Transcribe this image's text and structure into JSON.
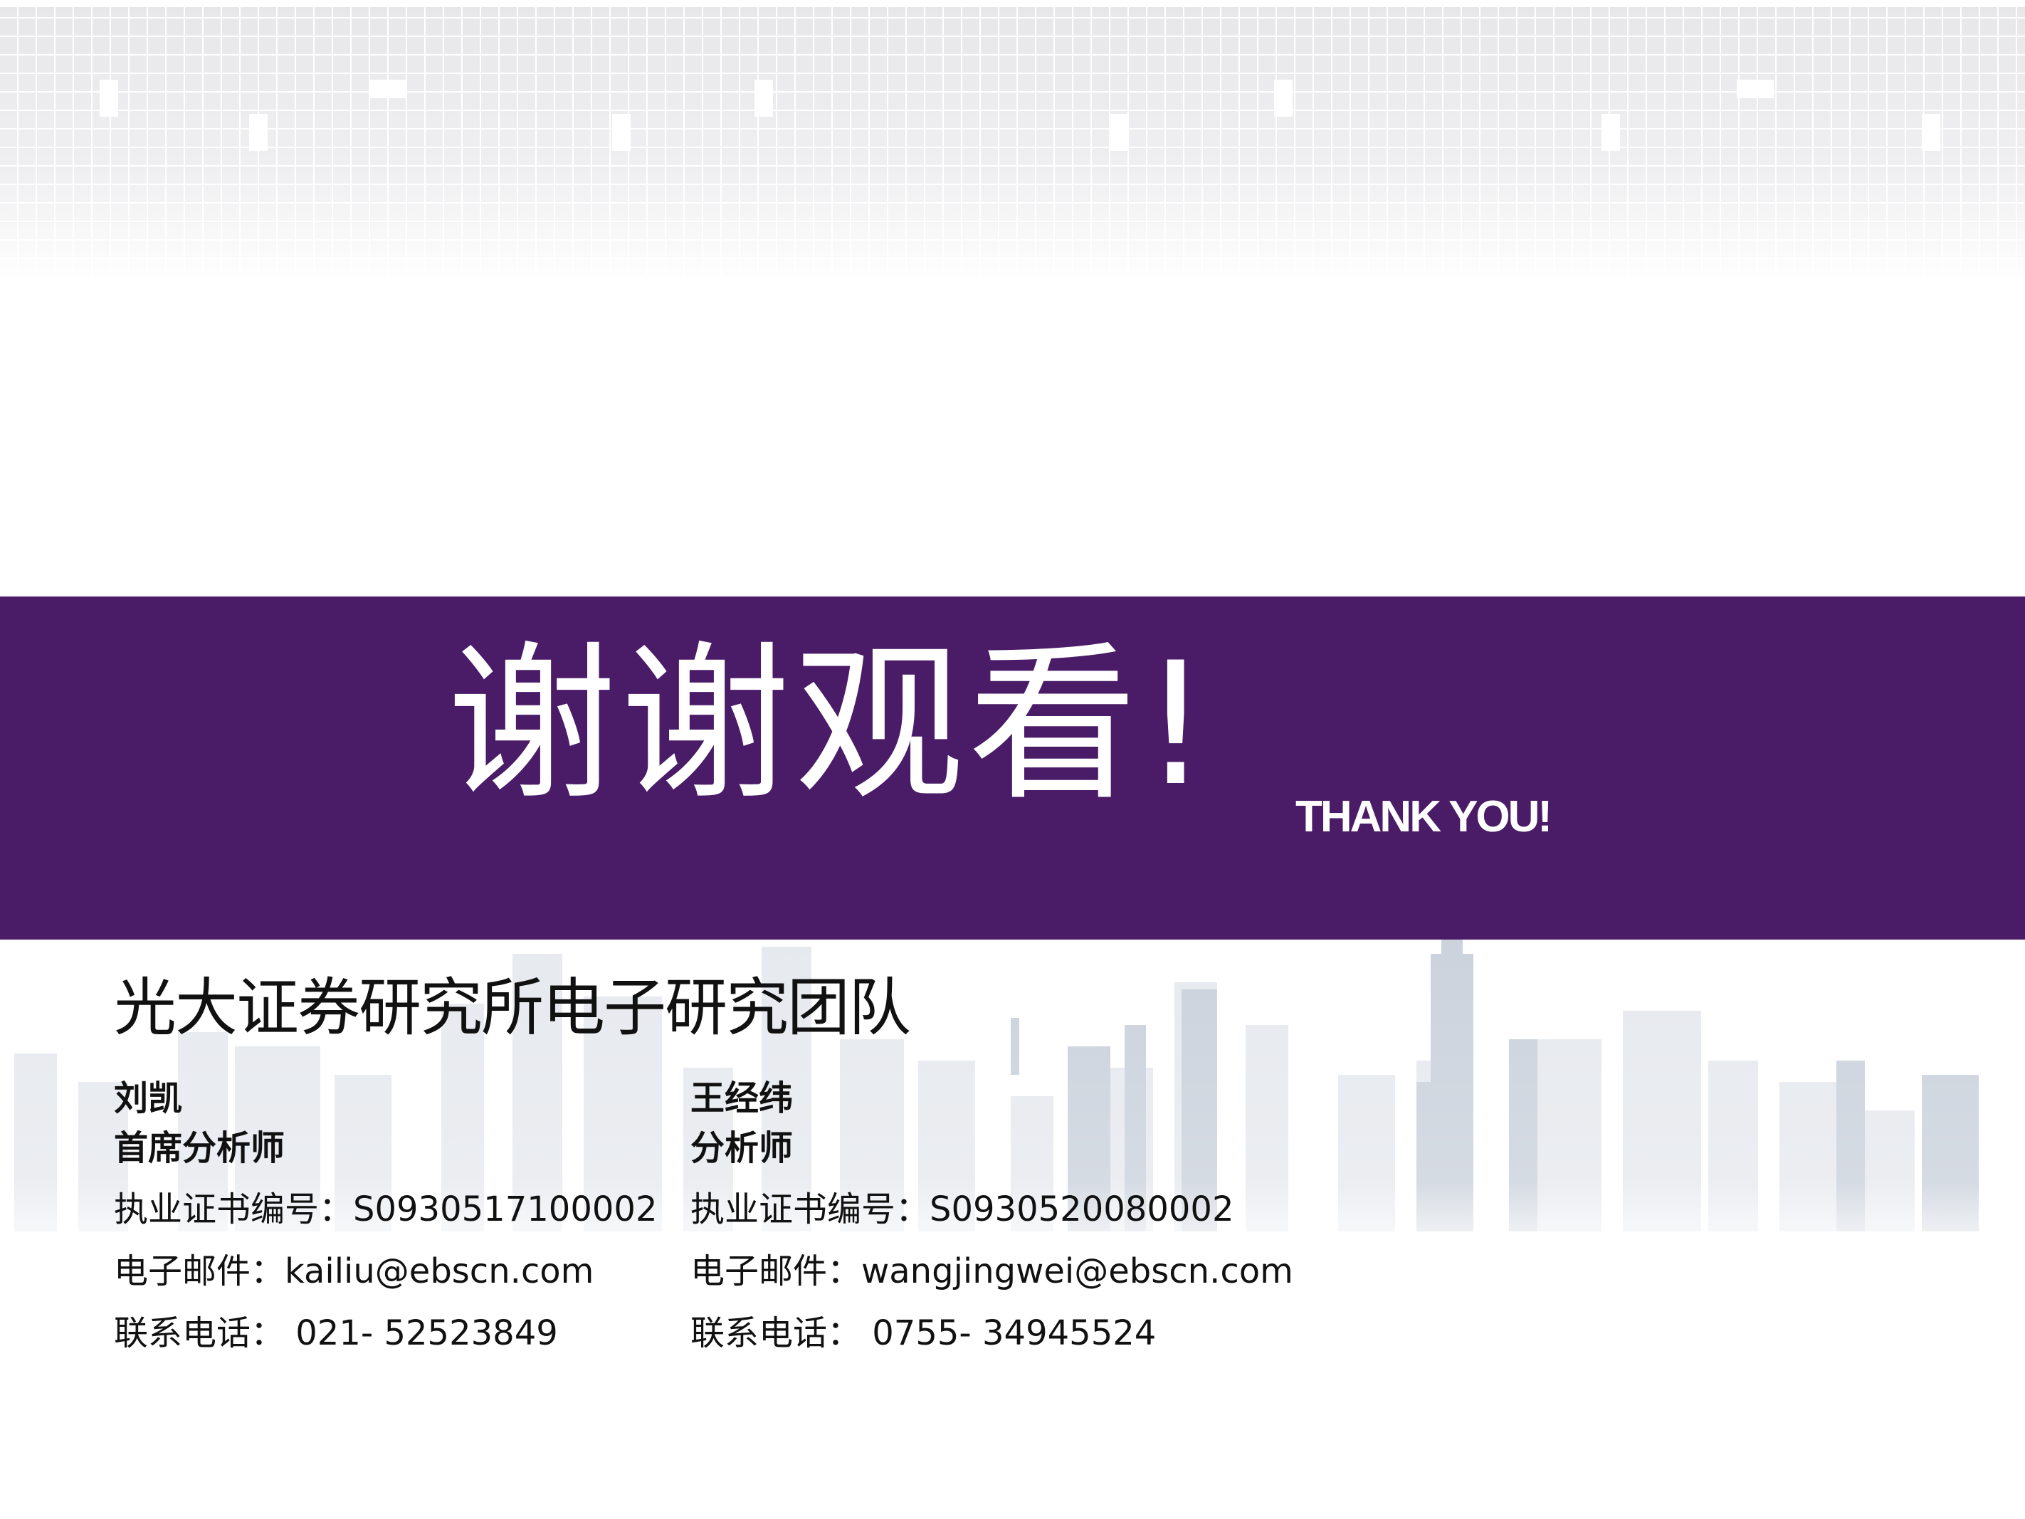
{
  "banner": {
    "title": "谢谢观看!",
    "subtitle": "THANK YOU!",
    "color": "#4a1c68"
  },
  "team": {
    "title": "光大证券研究所电子研究团队"
  },
  "analysts": [
    {
      "name": "刘凯",
      "role": "首席分析师",
      "license": "执业证书编号：S0930517100002",
      "email": "电子邮件：kailiu@ebscn.com",
      "phone": "联系电话： 021- 52523849"
    },
    {
      "name": "王经纬",
      "role": "分析师",
      "license": "执业证书编号：S0930520080002",
      "email": "电子邮件：wangjingwei@ebscn.com",
      "phone": "联系电话： 0755- 34945524"
    }
  ]
}
